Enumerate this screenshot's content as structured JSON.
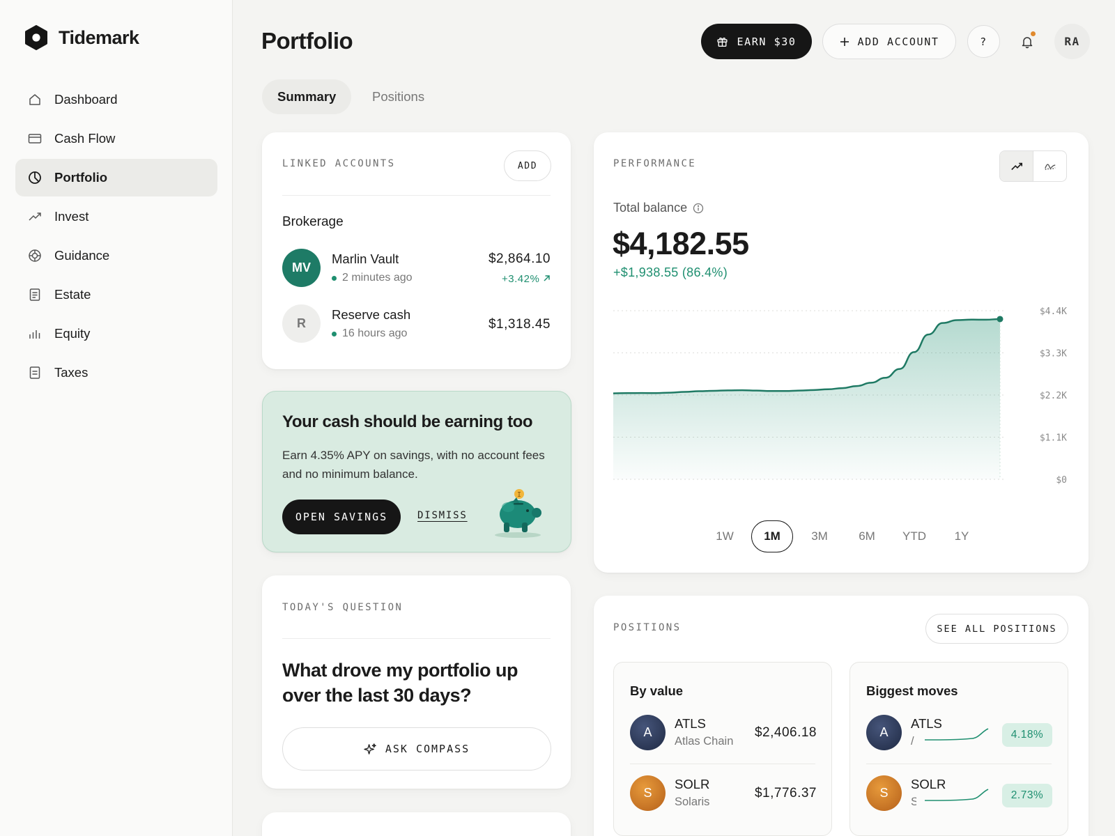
{
  "app": {
    "name": "Tidemark"
  },
  "sidebar": {
    "items": [
      {
        "label": "Dashboard",
        "icon": "home-icon",
        "active": false
      },
      {
        "label": "Cash Flow",
        "icon": "card-icon",
        "active": false
      },
      {
        "label": "Portfolio",
        "icon": "pie-icon",
        "active": true
      },
      {
        "label": "Invest",
        "icon": "trend-icon",
        "active": false
      },
      {
        "label": "Guidance",
        "icon": "target-icon",
        "active": false
      },
      {
        "label": "Estate",
        "icon": "document-icon",
        "active": false
      },
      {
        "label": "Equity",
        "icon": "bars-icon",
        "active": false
      },
      {
        "label": "Taxes",
        "icon": "receipt-icon",
        "active": false
      }
    ]
  },
  "header": {
    "title": "Portfolio",
    "earn_label": "EARN $30",
    "add_account_label": "ADD ACCOUNT",
    "help_label": "?",
    "avatar_initials": "RA",
    "notification_dot_color": "#e08a2e"
  },
  "tabs": [
    {
      "label": "Summary",
      "active": true
    },
    {
      "label": "Positions",
      "active": false
    }
  ],
  "linked_accounts": {
    "label": "LINKED ACCOUNTS",
    "add_label": "ADD",
    "group": "Brokerage",
    "accounts": [
      {
        "initials": "MV",
        "name": "Marlin Vault",
        "updated": "2 minutes ago",
        "amount": "$2,864.10",
        "change": "+3.42%"
      },
      {
        "initials": "R",
        "name": "Reserve cash",
        "updated": "16 hours ago",
        "amount": "$1,318.45",
        "change": ""
      }
    ]
  },
  "promo": {
    "title": "Your cash should be earning too",
    "body": "Earn 4.35% APY on savings, with no account fees and no minimum balance.",
    "cta": "OPEN SAVINGS",
    "dismiss": "DISMISS"
  },
  "question": {
    "label": "TODAY'S QUESTION",
    "text": "What drove my portfolio up over the last 30 days?",
    "cta": "ASK COMPASS"
  },
  "performance": {
    "label": "PERFORMANCE",
    "balance_label": "Total balance",
    "balance": "$4,182.55",
    "change": "+$1,938.55 (86.4%)",
    "ranges": [
      {
        "label": "1W",
        "selected": false
      },
      {
        "label": "1M",
        "selected": true
      },
      {
        "label": "3M",
        "selected": false
      },
      {
        "label": "6M",
        "selected": false
      },
      {
        "label": "YTD",
        "selected": false
      },
      {
        "label": "1Y",
        "selected": false
      }
    ]
  },
  "positions": {
    "label": "POSITIONS",
    "see_all": "SEE ALL POSITIONS",
    "by_value_title": "By value",
    "by_value": [
      {
        "initial": "A",
        "ticker": "ATLS",
        "company": "Atlas Chain",
        "value": "$2,406.18"
      },
      {
        "initial": "S",
        "ticker": "SOLR",
        "company": "Solaris",
        "value": "$1,776.37"
      }
    ],
    "moves_title": "Biggest moves",
    "moves": [
      {
        "initial": "A",
        "ticker": "ATLS",
        "company_clip": "/",
        "pct": "4.18%"
      },
      {
        "initial": "S",
        "ticker": "SOLR",
        "company_clip": "S",
        "pct": "2.73%"
      }
    ]
  },
  "chart_data": {
    "type": "area",
    "title": "",
    "xlabel": "",
    "ylabel": "",
    "y_ticks": [
      "$4.4K",
      "$3.3K",
      "$2.2K",
      "$1.1K",
      "$0"
    ],
    "ylim": [
      0,
      4400
    ],
    "grid": true,
    "color": "#1f7a64",
    "series": [
      {
        "values": [
          2244,
          2250,
          2252,
          2250,
          2262,
          2282,
          2300,
          2310,
          2320,
          2325,
          2315,
          2305,
          2305,
          2315,
          2330,
          2350,
          2380,
          2435,
          2520,
          2650,
          2880,
          3320,
          3780,
          4080,
          4155,
          4168,
          4165,
          4182.55
        ]
      }
    ]
  }
}
